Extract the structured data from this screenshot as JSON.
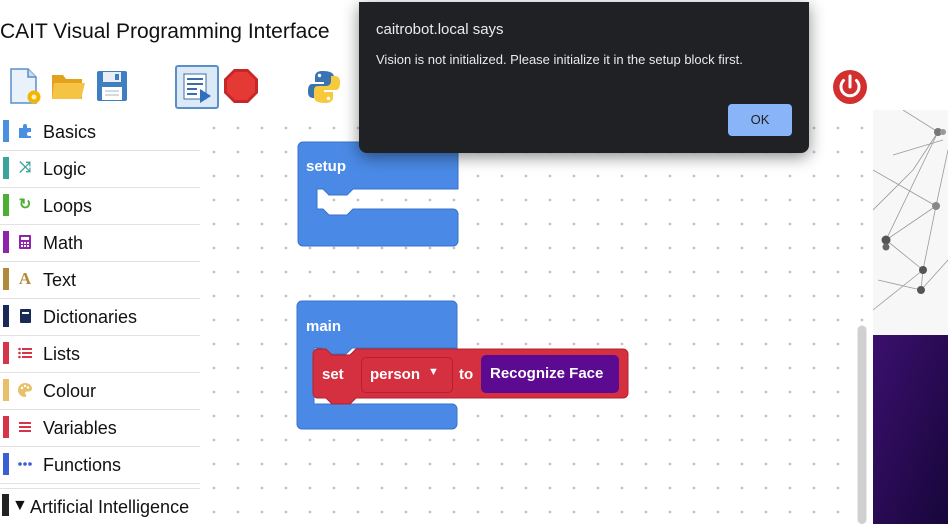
{
  "app": {
    "title": "CAIT Visual Programming Interface"
  },
  "toolbar": {
    "new_file": "new-file-icon",
    "open_folder": "folder-icon",
    "save": "save-icon",
    "run": "run-icon",
    "stop": "stop-icon",
    "python": "python-icon",
    "power": "power-icon"
  },
  "sidebar": {
    "items": [
      {
        "label": "Basics",
        "color": "#4a90e2",
        "icon": "puzzle-icon"
      },
      {
        "label": "Logic",
        "color": "#3aa39a",
        "icon": "shuffle-icon"
      },
      {
        "label": "Loops",
        "color": "#4caf34",
        "icon": "loop-icon"
      },
      {
        "label": "Math",
        "color": "#8e24aa",
        "icon": "calculator-icon"
      },
      {
        "label": "Text",
        "color": "#b0893a",
        "icon": "text-icon"
      },
      {
        "label": "Dictionaries",
        "color": "#1a2a57",
        "icon": "book-icon"
      },
      {
        "label": "Lists",
        "color": "#d63448",
        "icon": "list-icon"
      },
      {
        "label": "Colour",
        "color": "#e8c06a",
        "icon": "palette-icon"
      },
      {
        "label": "Variables",
        "color": "#d63448",
        "icon": "variables-icon"
      },
      {
        "label": "Functions",
        "color": "#3a5fd1",
        "icon": "dots-icon"
      }
    ],
    "ai_section": {
      "arrow": "▼",
      "label": "Artificial Intelligence",
      "color": "#222222"
    }
  },
  "blocks": {
    "setup": {
      "label": "setup",
      "color": "#4a8ae6"
    },
    "main": {
      "label": "main",
      "color": "#4a8ae6"
    },
    "set": {
      "label": "set",
      "variable": "person",
      "to_label": "to",
      "value": "Recognize Face",
      "color": "#d4303f",
      "value_color": "#5b0a91"
    }
  },
  "dialog": {
    "title": "caitrobot.local says",
    "message": "Vision is not initialized. Please initialize it in the setup block first.",
    "ok_label": "OK"
  }
}
